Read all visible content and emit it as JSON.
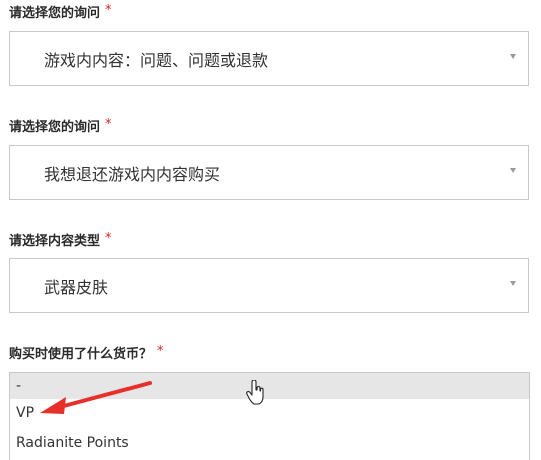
{
  "fields": [
    {
      "label": "请选择您的询问",
      "required": "*",
      "value": "游戏内内容：问题、问题或退款"
    },
    {
      "label": "请选择您的询问",
      "required": "*",
      "value": "我想退还游戏内内容购买"
    },
    {
      "label": "请选择内容类型",
      "required": "*",
      "value": "武器皮肤"
    }
  ],
  "currency": {
    "label": "购买时使用了什么货币？",
    "required": "*",
    "options": [
      "-",
      "VP",
      "Radianite Points"
    ],
    "highlighted_index": 0
  },
  "colors": {
    "required": "#d0261c",
    "arrow": "#e8302a",
    "highlight": "#e6e6e6"
  },
  "icons": [
    "caret-down-icon",
    "red-arrow-annotation",
    "hand-cursor-icon"
  ]
}
